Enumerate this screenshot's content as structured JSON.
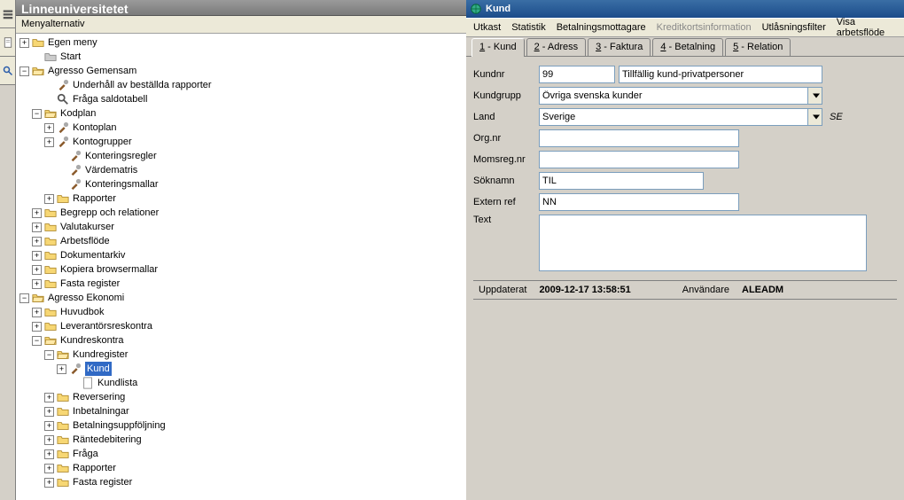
{
  "app_title": "Linneuniversitetet",
  "menu_label": "Menyalternativ",
  "side_tab_meny": "Meny",
  "tree": {
    "egen_meny": "Egen meny",
    "start": "Start",
    "agresso_gemensam": "Agresso Gemensam",
    "underhall": "Underhåll av beställda rapporter",
    "fraga_saldotabell": "Fråga saldotabell",
    "kodplan": "Kodplan",
    "kontoplan": "Kontoplan",
    "kontogrupper": "Kontogrupper",
    "konteringsregler": "Konteringsregler",
    "vardematris": "Värdematris",
    "konteringsmallar": "Konteringsmallar",
    "rapporter": "Rapporter",
    "begrepp": "Begrepp och relationer",
    "valutakurser": "Valutakurser",
    "arbetsflode": "Arbetsflöde",
    "dokumentarkiv": "Dokumentarkiv",
    "kopiera": "Kopiera browsermallar",
    "fasta_register": "Fasta register",
    "agresso_ekonomi": "Agresso Ekonomi",
    "huvudbok": "Huvudbok",
    "leverantorsreskontra": "Leverantörsreskontra",
    "kundreskontra": "Kundreskontra",
    "kundregister": "Kundregister",
    "kund": "Kund",
    "kundlista": "Kundlista",
    "reversering": "Reversering",
    "inbetalningar": "Inbetalningar",
    "betalningsuppfoljning": "Betalningsuppföljning",
    "rantedebitering": "Räntedebitering",
    "fraga": "Fråga",
    "rapporter2": "Rapporter",
    "fasta_register2": "Fasta register"
  },
  "window": {
    "title": "Kund",
    "toolbar": {
      "utkast": "Utkast",
      "statistik": "Statistik",
      "betalningsmottagare": "Betalningsmottagare",
      "kreditkortsinformation": "Kreditkortsinformation",
      "utlasningsfilter": "Utlåsningsfilter",
      "visa_arbetsflode": "Visa arbetsflöde"
    },
    "tabs": {
      "kund": "1 - Kund",
      "adress": "2 - Adress",
      "faktura": "3 - Faktura",
      "betalning": "4 - Betalning",
      "relation": "5 - Relation"
    },
    "form": {
      "kundnr_label": "Kundnr",
      "kundnr_value": "99",
      "kundnr_desc": "Tillfällig kund-privatpersoner",
      "kundgrupp_label": "Kundgrupp",
      "kundgrupp_value": "Övriga svenska kunder",
      "land_label": "Land",
      "land_value": "Sverige",
      "land_code": "SE",
      "orgnr_label": "Org.nr",
      "orgnr_value": "",
      "momsregnr_label": "Momsreg.nr",
      "momsregnr_value": "",
      "soknamn_label": "Söknamn",
      "soknamn_value": "TIL",
      "externref_label": "Extern ref",
      "externref_value": "NN",
      "text_label": "Text",
      "text_value": ""
    },
    "status": {
      "uppdaterat_label": "Uppdaterat",
      "uppdaterat_value": "2009-12-17 13:58:51",
      "anvandare_label": "Användare",
      "anvandare_value": "ALEADM"
    }
  }
}
